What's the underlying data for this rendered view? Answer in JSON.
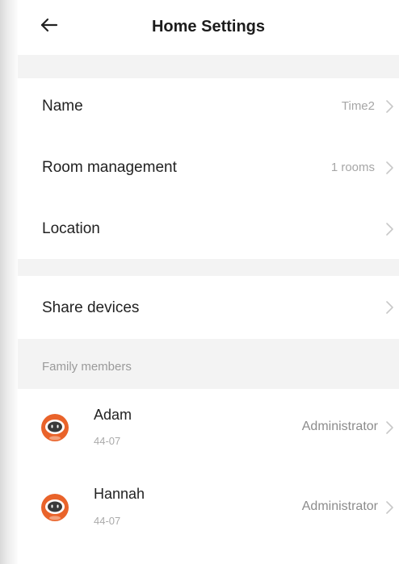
{
  "header": {
    "title": "Home Settings",
    "back_icon": "arrow-left-icon"
  },
  "settings": {
    "name": {
      "label": "Name",
      "value": "Time2"
    },
    "room_management": {
      "label": "Room management",
      "value": "1 rooms"
    },
    "location": {
      "label": "Location",
      "value": ""
    },
    "share_devices": {
      "label": "Share devices"
    }
  },
  "family": {
    "section_label": "Family members",
    "members": [
      {
        "name": "Adam",
        "subtitle": "44-07",
        "role": "Administrator"
      },
      {
        "name": "Hannah",
        "subtitle": "44-07",
        "role": "Administrator"
      }
    ]
  },
  "colors": {
    "background": "#ffffff",
    "section_gap": "#f3f3f3",
    "value_text": "#a6a6a6",
    "avatar_orange": "#e9632a",
    "avatar_dark": "#3a3a3a"
  }
}
